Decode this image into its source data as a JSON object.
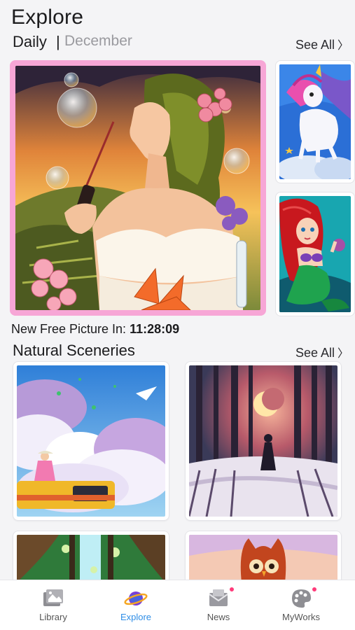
{
  "header": {
    "title": "Explore",
    "daily_label": "Daily",
    "separator": "|",
    "month": "December",
    "see_all": "See All",
    "see_all_chevron": "〉"
  },
  "daily": {
    "main_picture": "daily-picture-girl-bubbles",
    "side_pictures": [
      "daily-picture-unicorn",
      "daily-picture-mermaid"
    ],
    "free_picture_label": "New Free Picture In:",
    "free_picture_time": "11:28:09"
  },
  "natural_sceneries": {
    "title": "Natural Sceneries",
    "see_all": "See All",
    "see_all_chevron": "〉"
  },
  "tabbar": {
    "tabs": [
      {
        "label": "Library",
        "icon": "library-icon",
        "active": false,
        "badge": false
      },
      {
        "label": "Explore",
        "icon": "planet-icon",
        "active": true,
        "badge": false
      },
      {
        "label": "News",
        "icon": "envelope-icon",
        "active": false,
        "badge": true
      },
      {
        "label": "MyWorks",
        "icon": "palette-icon",
        "active": false,
        "badge": true
      }
    ]
  },
  "colors": {
    "accent": "#2e8de6",
    "highlight_border": "#f7a6d6",
    "badge": "#ff3b7a"
  }
}
